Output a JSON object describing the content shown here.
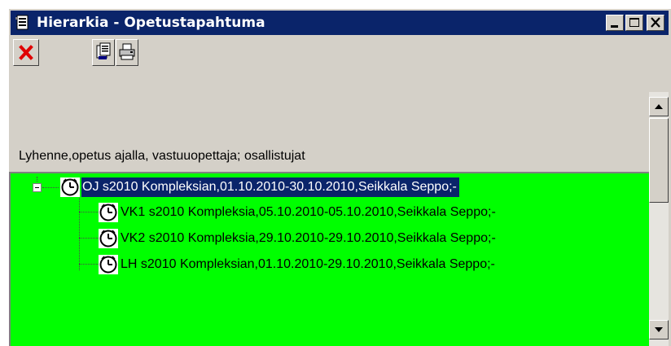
{
  "window": {
    "title": "Hierarkia - Opetustapahtuma",
    "icon": "document-tree-icon",
    "controls": [
      "minimize-icon",
      "maximize-icon",
      "close-icon"
    ]
  },
  "toolbar": {
    "buttons": [
      {
        "name": "delete",
        "icon": "red-x-icon"
      },
      {
        "name": "details",
        "icon": "document-icon"
      },
      {
        "name": "print",
        "icon": "printer-icon"
      }
    ]
  },
  "tree": {
    "column_header": "Lyhenne,opetus ajalla, vastuuopettaja; osallistujat",
    "background": "#00ff00",
    "root": {
      "label": "OJ s2010 Kompleksian,01.10.2010-30.10.2010,Seikkala Seppo;-",
      "expanded": true,
      "selected": true,
      "icon": "clock-icon"
    },
    "children": [
      {
        "label": "VK1 s2010 Kompleksia,05.10.2010-05.10.2010,Seikkala Seppo;-",
        "icon": "clock-icon"
      },
      {
        "label": "VK2 s2010 Kompleksia,29.10.2010-29.10.2010,Seikkala Seppo;-",
        "icon": "clock-icon"
      },
      {
        "label": "LH s2010 Kompleksian,01.10.2010-29.10.2010,Seikkala Seppo;-",
        "icon": "clock-icon"
      }
    ]
  },
  "colors": {
    "titlebar": "#0a246a",
    "selection": "#0a246a",
    "window_face": "#d4d0c8"
  }
}
